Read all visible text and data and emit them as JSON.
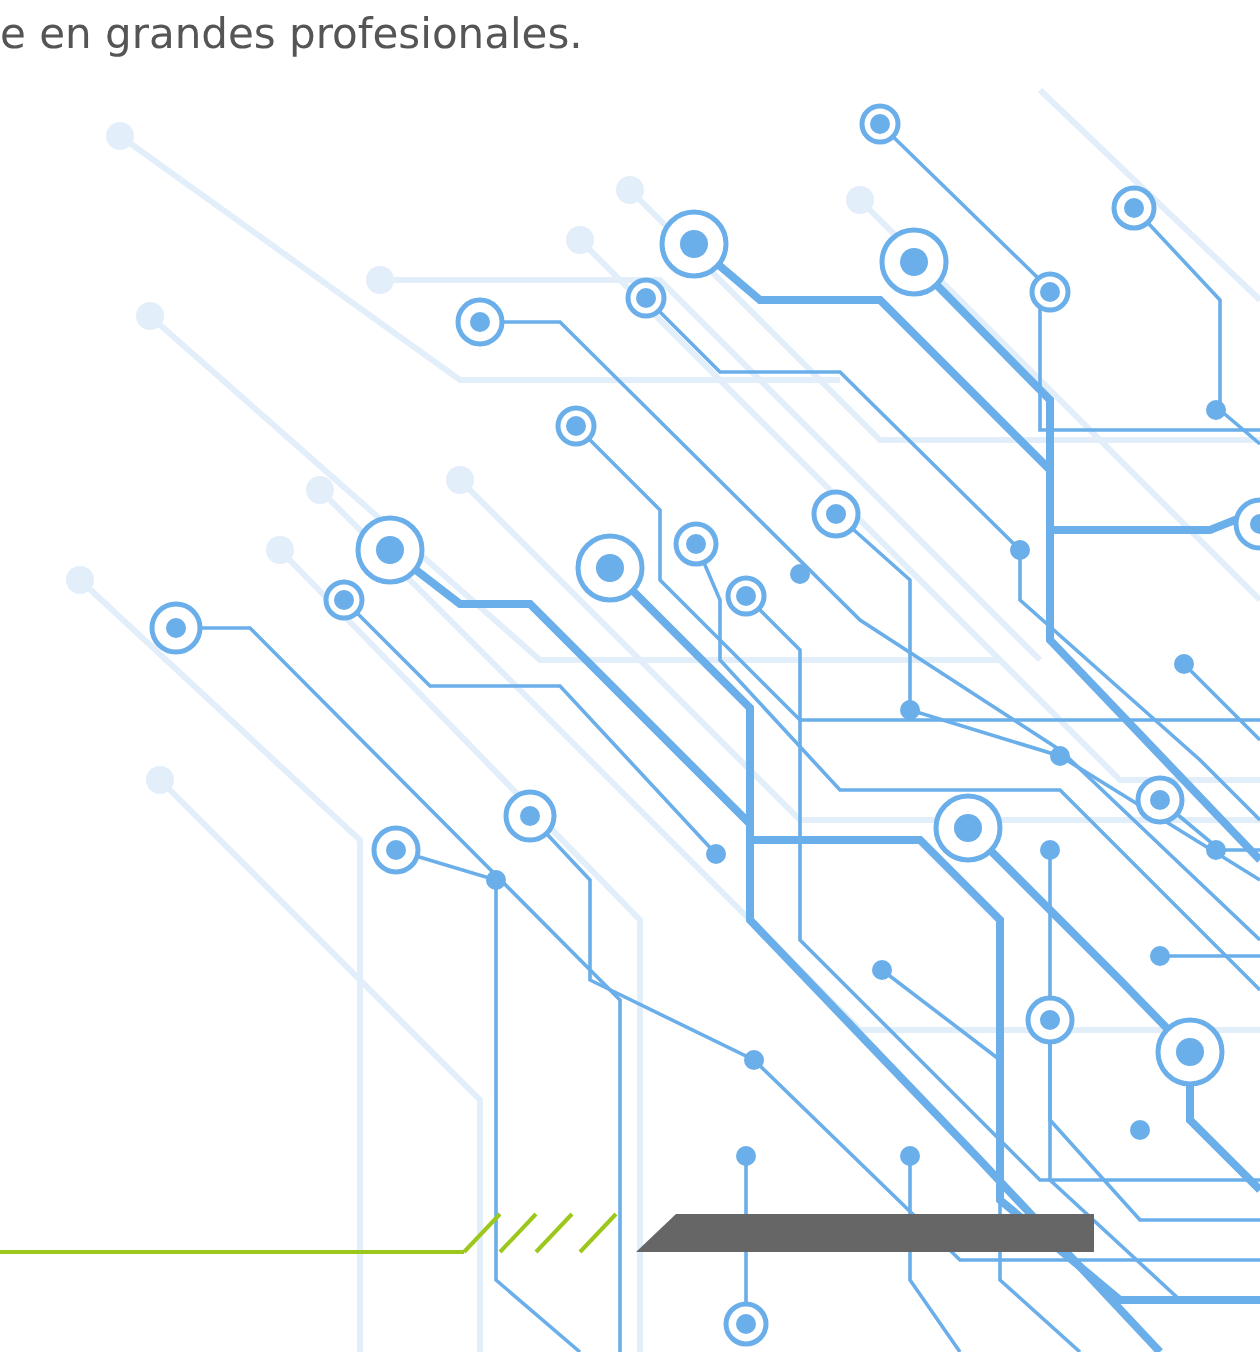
{
  "tagline": "e en grandes profesionales."
}
